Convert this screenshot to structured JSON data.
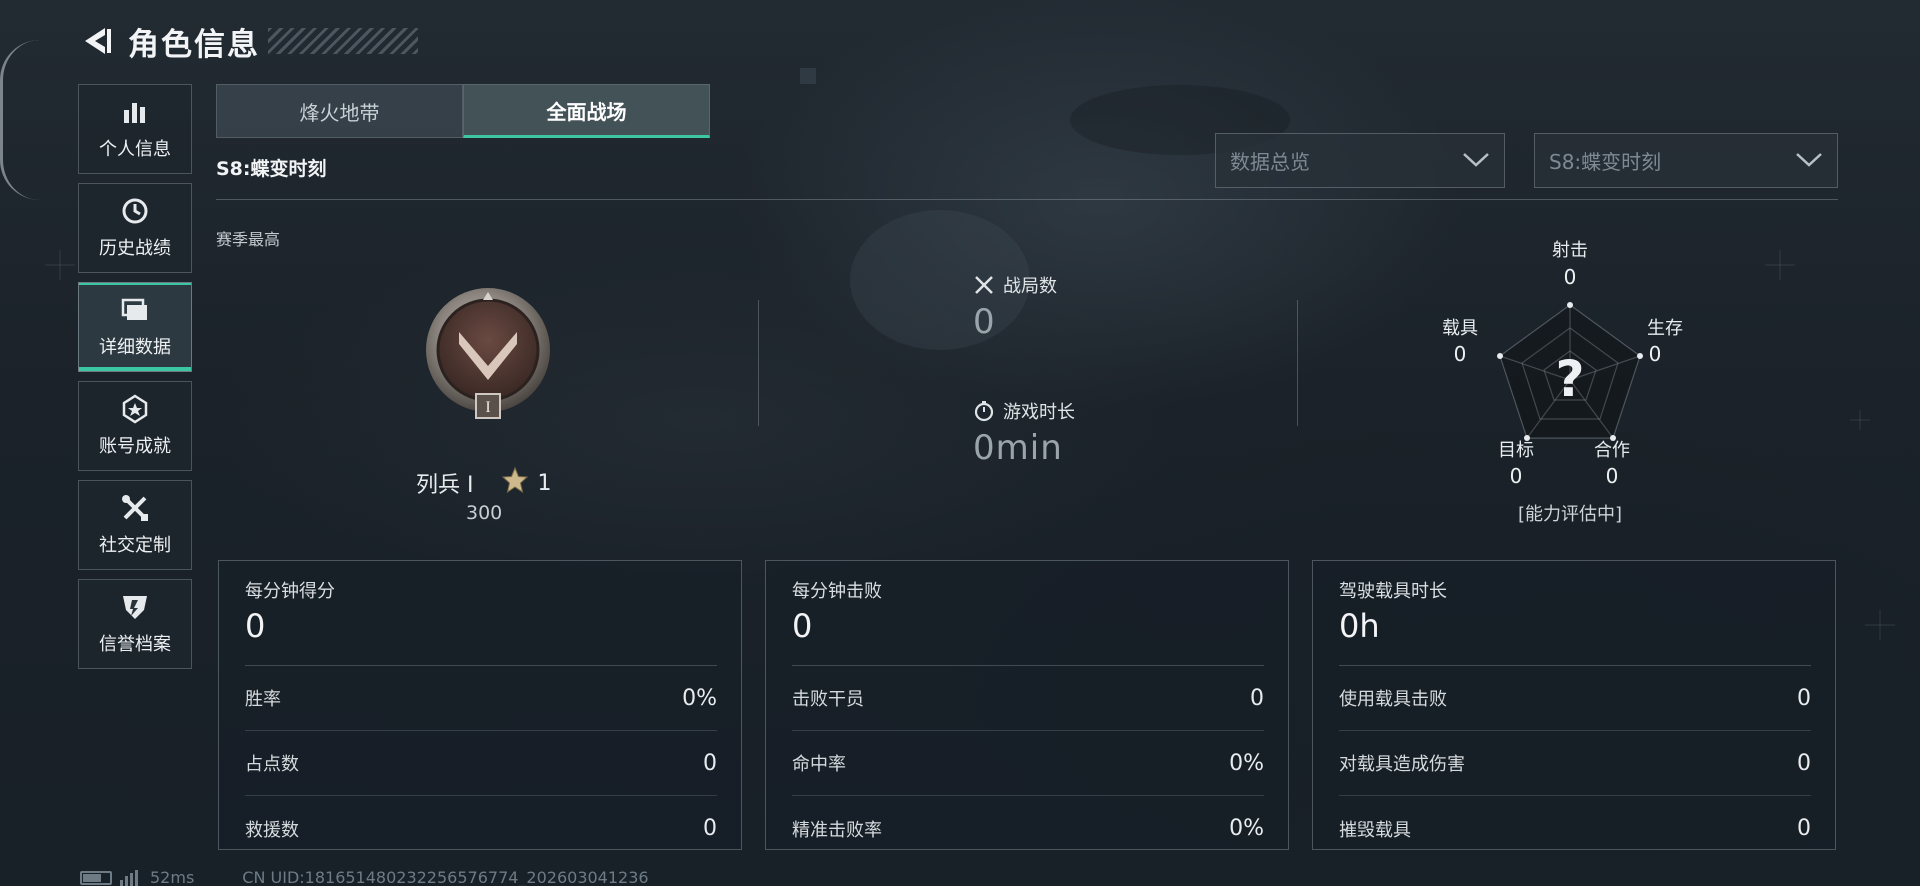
{
  "header": {
    "title": "角色信息"
  },
  "sidebar": {
    "items": [
      {
        "label": "个人信息",
        "icon": "bar-chart-icon"
      },
      {
        "label": "历史战绩",
        "icon": "history-icon"
      },
      {
        "label": "详细数据",
        "icon": "folder-icon",
        "active": true
      },
      {
        "label": "账号成就",
        "icon": "medal-icon"
      },
      {
        "label": "社交定制",
        "icon": "tools-icon"
      },
      {
        "label": "信誉档案",
        "icon": "shield-icon"
      }
    ]
  },
  "tabs": [
    {
      "label": "烽火地带",
      "active": false
    },
    {
      "label": "全面战场",
      "active": true
    }
  ],
  "season_label": "S8:蝶变时刻",
  "filters": {
    "view": "数据总览",
    "season": "S8:蝶变时刻"
  },
  "season_best": "赛季最高",
  "rank": {
    "name": "列兵 I",
    "stars": "1",
    "points": "300",
    "badge_numeral": "I"
  },
  "overview": {
    "matches_label": "战局数",
    "matches_value": "0",
    "playtime_label": "游戏时长",
    "playtime_value": "0min"
  },
  "radar": {
    "axes": [
      {
        "label": "射击",
        "value": "0"
      },
      {
        "label": "生存",
        "value": "0"
      },
      {
        "label": "合作",
        "value": "0"
      },
      {
        "label": "目标",
        "value": "0"
      },
      {
        "label": "载具",
        "value": "0"
      }
    ],
    "center_symbol": "?",
    "status": "[能力评估中]"
  },
  "cards": [
    {
      "title": "每分钟得分",
      "value": "0",
      "rows": [
        {
          "label": "胜率",
          "value": "0%"
        },
        {
          "label": "占点数",
          "value": "0"
        },
        {
          "label": "救援数",
          "value": "0"
        }
      ]
    },
    {
      "title": "每分钟击败",
      "value": "0",
      "rows": [
        {
          "label": "击败干员",
          "value": "0"
        },
        {
          "label": "命中率",
          "value": "0%"
        },
        {
          "label": "精准击败率",
          "value": "0%"
        }
      ]
    },
    {
      "title": "驾驶载具时长",
      "value": "0h",
      "rows": [
        {
          "label": "使用载具击败",
          "value": "0"
        },
        {
          "label": "对载具造成伤害",
          "value": "0"
        },
        {
          "label": "摧毁载具",
          "value": "0"
        }
      ]
    }
  ],
  "footer": {
    "ping": "52ms",
    "uid": "CN UID:181651480232256576774_202603041236"
  },
  "colors": {
    "accent": "#3cc6a2",
    "background": "#1d242c"
  }
}
